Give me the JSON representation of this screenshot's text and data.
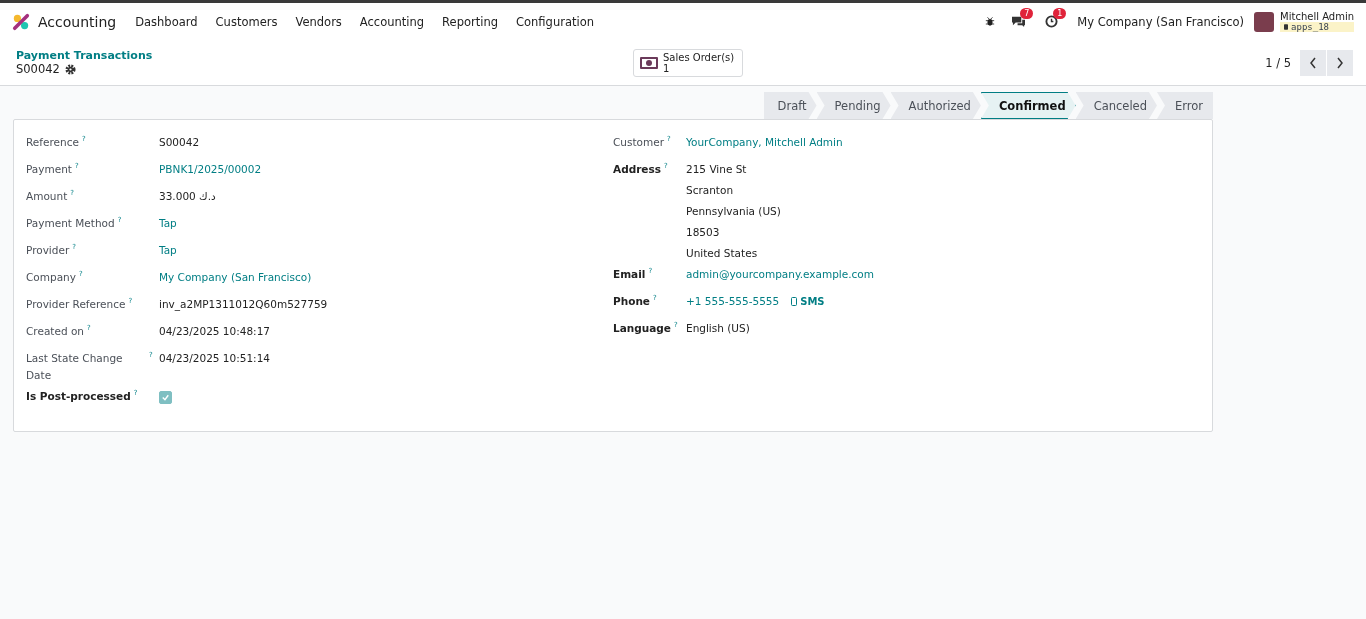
{
  "navbar": {
    "app_name": "Accounting",
    "menu": [
      "Dashboard",
      "Customers",
      "Vendors",
      "Accounting",
      "Reporting",
      "Configuration"
    ],
    "messages_count": "7",
    "activities_count": "1",
    "company": "My Company (San Francisco)",
    "user_name": "Mitchell Admin",
    "database": "apps_18"
  },
  "breadcrumb": {
    "parent": "Payment Transactions",
    "current": "S00042"
  },
  "smart_button": {
    "label": "Sales Order(s)",
    "count": "1"
  },
  "pager": {
    "text": "1 / 5"
  },
  "statusbar": [
    {
      "label": "Draft",
      "selected": false
    },
    {
      "label": "Pending",
      "selected": false
    },
    {
      "label": "Authorized",
      "selected": false
    },
    {
      "label": "Confirmed",
      "selected": true
    },
    {
      "label": "Canceled",
      "selected": false
    },
    {
      "label": "Error",
      "selected": false
    }
  ],
  "left_fields": [
    {
      "kind": "text",
      "label": "Reference",
      "bold": false,
      "help": "?",
      "value": "S00042"
    },
    {
      "kind": "link",
      "label": "Payment",
      "bold": false,
      "help": "?",
      "value": "PBNK1/2025/00002"
    },
    {
      "kind": "text",
      "label": "Amount",
      "bold": false,
      "help": "?",
      "value": "33.000 د.ك"
    },
    {
      "kind": "link",
      "label": "Payment Method",
      "bold": false,
      "help": "?",
      "value": "Tap"
    },
    {
      "kind": "link",
      "label": "Provider",
      "bold": false,
      "help": "?",
      "value": "Tap"
    },
    {
      "kind": "link",
      "label": "Company",
      "bold": false,
      "help": "?",
      "value": "My Company (San Francisco)"
    },
    {
      "kind": "text",
      "label": "Provider Reference",
      "bold": false,
      "help": "?",
      "value": "inv_a2MP1311012Q60m527759"
    },
    {
      "kind": "text",
      "label": "Created on",
      "bold": false,
      "help": "?",
      "value": "04/23/2025 10:48:17"
    },
    {
      "kind": "text",
      "label": "Last State Change Date",
      "bold": false,
      "help": "?",
      "value": "04/23/2025 10:51:14"
    },
    {
      "kind": "checkbox",
      "label": "Is Post-processed",
      "bold": true,
      "help": "?",
      "checked": true
    }
  ],
  "right_fields": [
    {
      "kind": "link",
      "label": "Customer",
      "bold": false,
      "help": "?",
      "value": "YourCompany, Mitchell Admin"
    },
    {
      "kind": "lines",
      "label": "Address",
      "bold": true,
      "help": "?",
      "lines": [
        "215 Vine St",
        "Scranton",
        "Pennsylvania (US)",
        "18503",
        "United States"
      ]
    },
    {
      "kind": "link",
      "label": "Email",
      "bold": true,
      "help": "?",
      "value": "admin@yourcompany.example.com"
    },
    {
      "kind": "phone",
      "label": "Phone",
      "bold": true,
      "help": "?",
      "value": "+1 555-555-5555",
      "action": "SMS"
    },
    {
      "kind": "text",
      "label": "Language",
      "bold": true,
      "help": "?",
      "value": "English (US)"
    }
  ]
}
